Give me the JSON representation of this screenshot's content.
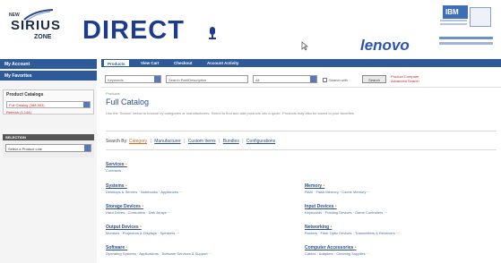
{
  "header": {
    "logo_new": "NEW",
    "logo_sirius": "SIRIUS",
    "logo_zone": "ZONE",
    "logo_direct": "DIRECT",
    "partner_logo": "lenovo",
    "ibm_text": "IBM"
  },
  "sidebar": {
    "bar1": "My Account",
    "bar2": "My Favorites",
    "catalog_title": "Product Catalogs",
    "catalog_value": "Full Catalog (388,593)",
    "catalog_note": "Refresh (1,144)",
    "selection_title": "SELECTION",
    "selection_value": "Select a Product Line"
  },
  "tabs": [
    {
      "label": "Products"
    },
    {
      "label": "View Cart"
    },
    {
      "label": "Checkout"
    },
    {
      "label": "Account Activity"
    }
  ],
  "search": {
    "field1": "Keywords",
    "field2": "Search Part/Description",
    "field3": "All",
    "check_label": "Search with",
    "button": "Search",
    "adv1": "Product Compare",
    "adv2": "Advanced Search"
  },
  "breadcrumb": "Products",
  "page_title": "Full Catalog",
  "description": "Use the 'Search' below to browse by categories or manufacturers. Select to find and add products into a quote. Products may also be saved to your favorites.",
  "search_by": {
    "label": "Search By:",
    "links": [
      "Category",
      "Manufacturer",
      "Custom Items",
      "Bundles",
      "Configurations"
    ]
  },
  "categories": {
    "services": {
      "title": "Services",
      "sub": "Contracts"
    },
    "left": [
      {
        "title": "Systems",
        "sub": "Desktops & Servers · Notebooks · Appliances ···"
      },
      {
        "title": "Storage Devices",
        "sub": "Hard Drives · Controllers · Disk Arrays ···"
      },
      {
        "title": "Output Devices",
        "sub": "Monitors · Projectors & Displays · Speakers ···"
      },
      {
        "title": "Software",
        "sub": "Operating Systems · Applications · Software Services & Support ···"
      }
    ],
    "right": [
      {
        "title": "Memory",
        "sub": "RAM · Flash Memory · Cache Memory ···"
      },
      {
        "title": "Input Devices",
        "sub": "Keyboards · Pointing Devices · Game Controllers ···"
      },
      {
        "title": "Networking",
        "sub": "Routers · Fiber Optic Devices · Transmitters & Receivers ···"
      },
      {
        "title": "Computer Accessories",
        "sub": "Cables · Adapters · Cleaning Supplies ···"
      }
    ]
  }
}
